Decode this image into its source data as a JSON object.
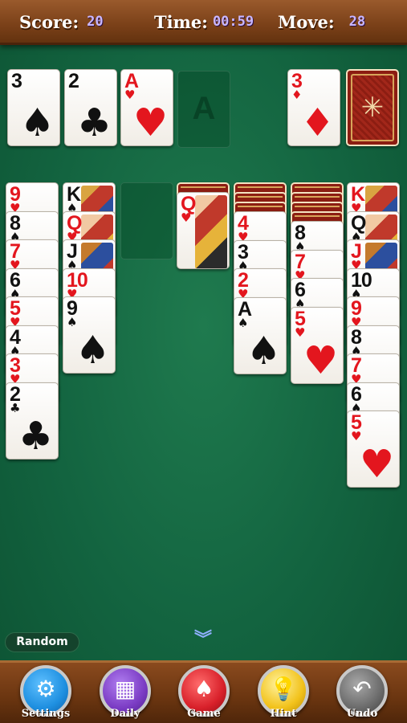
{
  "header": {
    "score_label": "Score:",
    "score_value": "20",
    "time_label": "Time:",
    "time_value": "00:59",
    "move_label": "Move:",
    "move_value": "28"
  },
  "foundation": {
    "piles": [
      {
        "rank": "3",
        "suit": "♠",
        "color": "black"
      },
      {
        "rank": "2",
        "suit": "♣",
        "color": "black"
      },
      {
        "rank": "A",
        "suit": "♥",
        "color": "red"
      }
    ],
    "empty_slot_label": "A"
  },
  "stock": {
    "waste_top": {
      "rank": "3",
      "suit": "♦",
      "color": "red"
    },
    "stock_back_icon": "spider-icon"
  },
  "tableau": [
    {
      "hidden": 0,
      "cards": [
        {
          "rank": "9",
          "suit": "♥",
          "color": "red"
        },
        {
          "rank": "8",
          "suit": "♠",
          "color": "black"
        },
        {
          "rank": "7",
          "suit": "♥",
          "color": "red"
        },
        {
          "rank": "6",
          "suit": "♠",
          "color": "black"
        },
        {
          "rank": "5",
          "suit": "♥",
          "color": "red"
        },
        {
          "rank": "4",
          "suit": "♠",
          "color": "black"
        },
        {
          "rank": "3",
          "suit": "♥",
          "color": "red"
        },
        {
          "rank": "2",
          "suit": "♣",
          "color": "black"
        }
      ]
    },
    {
      "hidden": 0,
      "cards": [
        {
          "rank": "K",
          "suit": "♠",
          "color": "black",
          "face": "k"
        },
        {
          "rank": "Q",
          "suit": "♥",
          "color": "red",
          "face": "q"
        },
        {
          "rank": "J",
          "suit": "♠",
          "color": "black",
          "face": "j"
        },
        {
          "rank": "10",
          "suit": "♥",
          "color": "red"
        },
        {
          "rank": "9",
          "suit": "♠",
          "color": "black"
        }
      ]
    },
    {
      "hidden": 0,
      "cards": []
    },
    {
      "hidden": 1,
      "cards": [
        {
          "rank": "Q",
          "suit": "♥",
          "color": "red",
          "face": "q"
        }
      ]
    },
    {
      "hidden": 3,
      "cards": [
        {
          "rank": "4",
          "suit": "♥",
          "color": "red"
        },
        {
          "rank": "3",
          "suit": "♠",
          "color": "black"
        },
        {
          "rank": "2",
          "suit": "♥",
          "color": "red"
        },
        {
          "rank": "A",
          "suit": "♠",
          "color": "black"
        }
      ]
    },
    {
      "hidden": 4,
      "cards": [
        {
          "rank": "8",
          "suit": "♠",
          "color": "black"
        },
        {
          "rank": "7",
          "suit": "♥",
          "color": "red"
        },
        {
          "rank": "6",
          "suit": "♠",
          "color": "black"
        },
        {
          "rank": "5",
          "suit": "♥",
          "color": "red"
        }
      ]
    },
    {
      "hidden": 0,
      "cards": [
        {
          "rank": "K",
          "suit": "♥",
          "color": "red",
          "face": "k"
        },
        {
          "rank": "Q",
          "suit": "♠",
          "color": "black",
          "face": "q"
        },
        {
          "rank": "J",
          "suit": "♥",
          "color": "red",
          "face": "j"
        },
        {
          "rank": "10",
          "suit": "♠",
          "color": "black"
        },
        {
          "rank": "9",
          "suit": "♥",
          "color": "red"
        },
        {
          "rank": "8",
          "suit": "♠",
          "color": "black"
        },
        {
          "rank": "7",
          "suit": "♥",
          "color": "red"
        },
        {
          "rank": "6",
          "suit": "♠",
          "color": "black"
        },
        {
          "rank": "5",
          "suit": "♥",
          "color": "red"
        }
      ]
    }
  ],
  "random_label": "Random",
  "toolbar": {
    "buttons": [
      {
        "label": "Settings",
        "icon": "gear-icon",
        "color": "#1e8fe0"
      },
      {
        "label": "Daily",
        "icon": "calendar-icon",
        "color": "#7b3cc4"
      },
      {
        "label": "Game",
        "icon": "spade-icon",
        "color": "#d8202a"
      },
      {
        "label": "Hint",
        "icon": "lightbulb-icon",
        "color": "#f2c21b"
      },
      {
        "label": "Undo",
        "icon": "undo-arrow-icon",
        "color": "#6b6b6b"
      }
    ]
  },
  "colors": {
    "felt": "#136440",
    "red_suit": "#e3161e",
    "wood": "#7a4018"
  }
}
